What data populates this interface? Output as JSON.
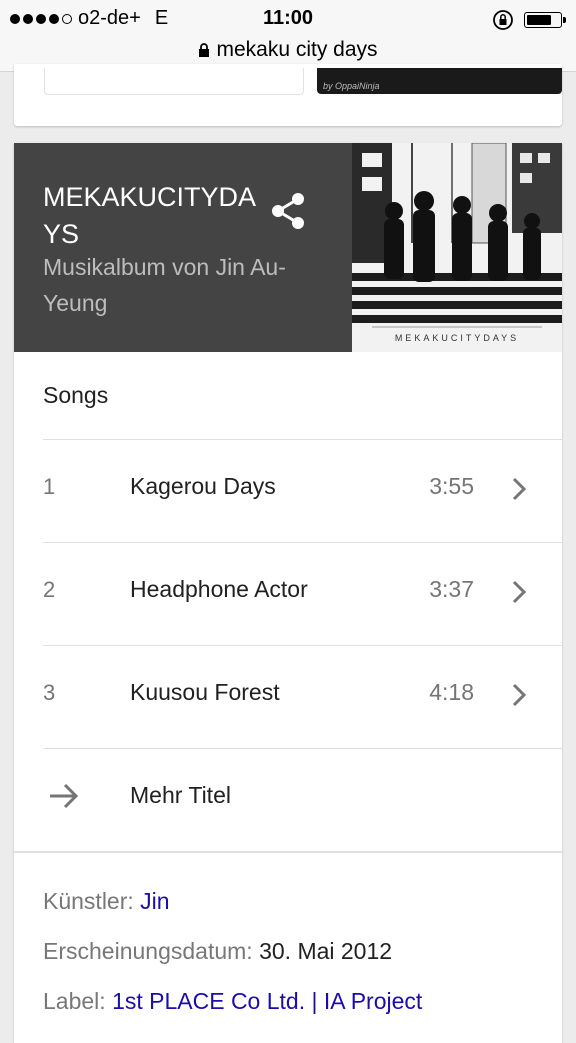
{
  "status_bar": {
    "carrier": "o2-de+",
    "network": "E",
    "time": "11:00",
    "url": "mekaku city days"
  },
  "previous_card": {
    "thumb_caption": "by OppaiNinja"
  },
  "album": {
    "title": "MEKAKUCITYDAYS",
    "subtitle": "Musikalbum von Jin Au-Yeung",
    "cover_text": "MEKAKUCITYDAYS"
  },
  "songs": {
    "heading": "Songs",
    "items": [
      {
        "num": "1",
        "title": "Kagerou Days",
        "duration": "3:55"
      },
      {
        "num": "2",
        "title": "Headphone Actor",
        "duration": "3:37"
      },
      {
        "num": "3",
        "title": "Kuusou Forest",
        "duration": "4:18"
      }
    ],
    "more_label": "Mehr Titel"
  },
  "info": {
    "artist_label": "Künstler:",
    "artist_value": "Jin",
    "release_label": "Erscheinungsdatum:",
    "release_value": "30. Mai 2012",
    "label_label": "Label:",
    "label_value": "1st PLACE Co Ltd. | IA Project"
  },
  "colors": {
    "header_bg": "#444444",
    "link": "#1a0dab",
    "page_bg": "#ececec"
  }
}
